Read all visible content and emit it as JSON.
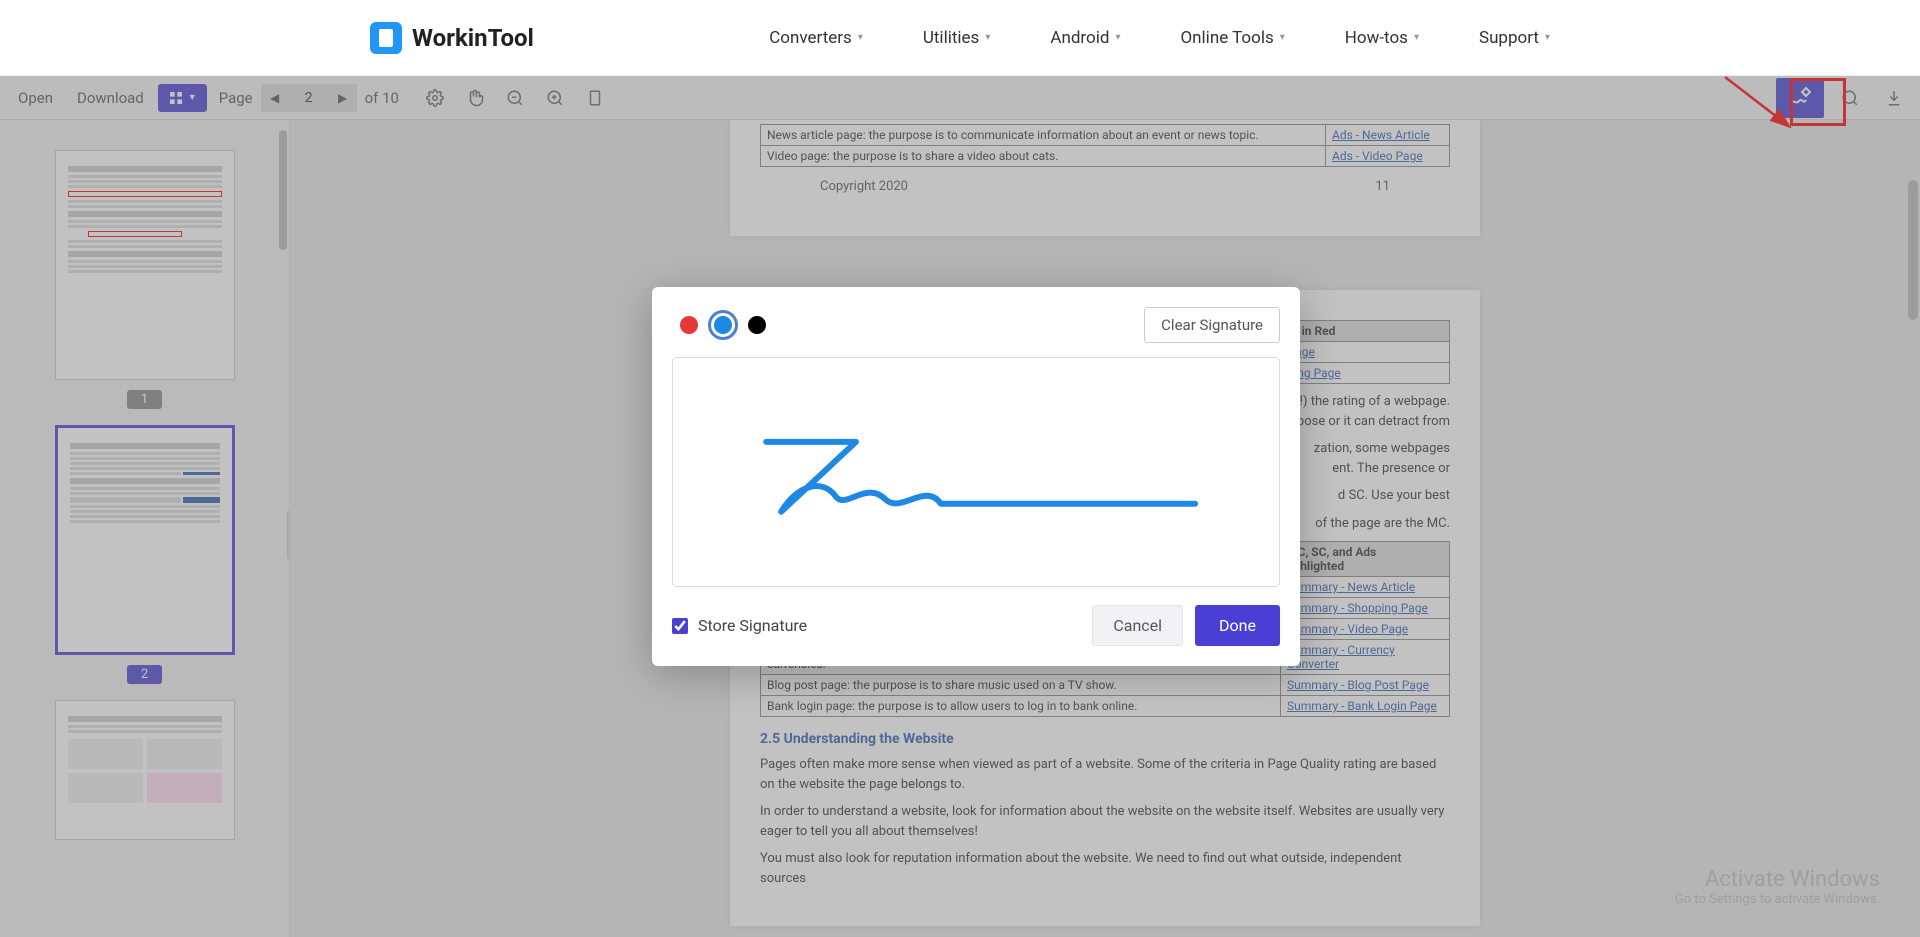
{
  "brand": "WorkinTool",
  "nav": {
    "converters": "Converters",
    "utilities": "Utilities",
    "android": "Android",
    "online": "Online Tools",
    "howtos": "How-tos",
    "support": "Support"
  },
  "toolbar": {
    "open": "Open",
    "download": "Download",
    "page_label": "Page",
    "page_current": "2",
    "page_total": "of 10"
  },
  "thumbs": {
    "p1": "1",
    "p2": "2"
  },
  "doc": {
    "row_news": "News article page: the purpose is to communicate information about an event or news topic.",
    "row_video": "Video page: the purpose is to share a video about cats.",
    "link_news": "Ads - News Article",
    "link_video": "Ads - Video Page",
    "copyright": "Copyright 2020",
    "pagenum": "11",
    "hdr_highlight": "s Highlighted in Red",
    "link_blog": "- Blog Post Page",
    "link_shop": "ads – Shopping Page",
    "frag_mc": "e.  MC is (or should be!) the rating of a webpage.\nrpose or it can detract from",
    "frag_mono": "zation, some webpages\nent.  The presence or",
    "frag_sc": "d SC.  Use your best",
    "frag_page_mc": "of the page are the MC.",
    "tbl_hdr": "MC, SC, and Ads\nlighlighted",
    "link_sum_news": "Summary - News Article",
    "link_sum_shop": "Summary - Shopping Page",
    "link_sum_video": "Summary - Video Page",
    "row_currency": "Currency converter page: the purpose is to calculate equivalent amounts in different currencies.",
    "link_sum_curr": "Summary - Currency Converter",
    "row_blog2": "Blog post page: the purpose is to share music used on a TV show.",
    "link_sum_blog": "Summary - Blog Post Page",
    "row_bank": "Bank login page: the purpose is to allow users to log in to bank online.",
    "link_sum_bank": "Summary - Bank Login Page",
    "h25": "2.5      Understanding the Website",
    "p_sense": "Pages often make more sense when viewed as part of a website.  Some of the criteria in Page Quality rating are based on the website the page belongs to.",
    "p_understand": "In order to understand a website, look for information about the website on the website itself.  Websites are usually very eager to tell you all about themselves!",
    "p_rep": "You must also look for reputation information about the website.  We need to find out what outside, independent sources"
  },
  "modal": {
    "clear": "Clear Signature",
    "store": "Store Signature",
    "cancel": "Cancel",
    "done": "Done",
    "colors": {
      "red": "#e53935",
      "blue": "#1e88e5",
      "black": "#000000"
    }
  },
  "watermark": {
    "title": "Activate Windows",
    "sub": "Go to Settings to activate Windows."
  }
}
